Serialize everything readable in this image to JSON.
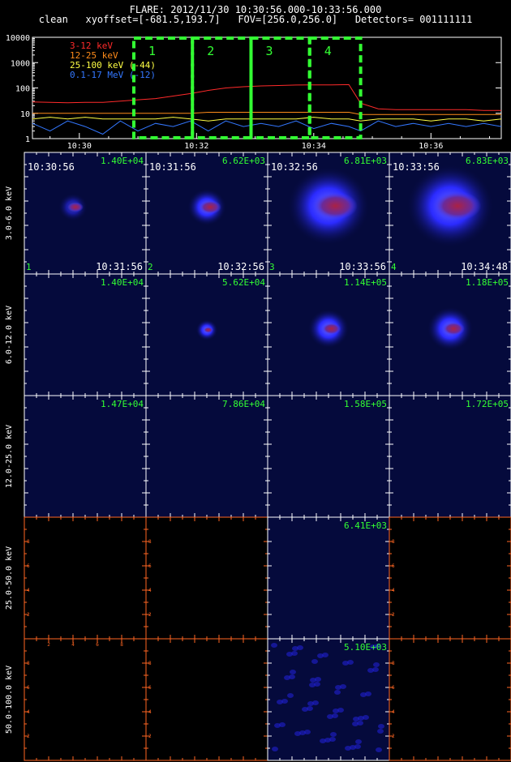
{
  "header": {
    "line1": "FLARE: 2012/11/30 10:30:56.000-10:33:56.000",
    "line2": "clean   xyoffset=[-681.5,193.7]   FOV=[256.0,256.0]   Detectors= 001111111"
  },
  "colors": {
    "bg": "#000000",
    "panel": "#050a3c",
    "frame": "#ffffff",
    "empty_frame": "#ff6622",
    "label_green": "#33ff33",
    "window_box": "#33ff33"
  },
  "chart_data": [
    {
      "type": "line",
      "title": "",
      "xlabel": "",
      "ylabel": "",
      "yscale": "log",
      "ylim": [
        1,
        10000
      ],
      "y_ticks": [
        "1",
        "10",
        "100",
        "1000",
        "10000"
      ],
      "x_ticks": [
        "10:30",
        "10:32",
        "10:34",
        "10:36"
      ],
      "x_tick_minutes": [
        30,
        32,
        34,
        36
      ],
      "xlim_minutes": [
        29.2,
        37.2
      ],
      "x": [
        29.2,
        29.5,
        29.8,
        30.1,
        30.4,
        30.7,
        31.0,
        31.3,
        31.6,
        31.9,
        32.2,
        32.5,
        32.8,
        33.1,
        33.4,
        33.7,
        34.0,
        34.3,
        34.6,
        34.8,
        35.1,
        35.4,
        35.7,
        36.0,
        36.3,
        36.6,
        36.9,
        37.2
      ],
      "series": [
        {
          "name": "3-12 keV",
          "color": "#ff2a2a",
          "values": [
            28,
            27,
            26,
            27,
            27,
            30,
            34,
            38,
            48,
            60,
            80,
            100,
            112,
            120,
            125,
            130,
            132,
            132,
            135,
            25,
            15,
            14,
            14,
            14,
            14,
            14,
            13,
            13
          ]
        },
        {
          "name": "12-25 keV",
          "color": "#ff8c1a",
          "values": [
            10,
            10,
            10,
            10,
            10,
            10,
            10,
            10,
            10,
            10,
            11,
            11,
            11,
            11,
            11,
            11,
            11,
            11,
            11,
            9,
            9,
            9,
            9,
            9,
            9,
            9,
            9,
            9
          ]
        },
        {
          "name": "25-100 keV (-44)",
          "color": "#ffff44",
          "values": [
            6,
            7,
            6,
            7,
            6,
            6,
            6,
            6,
            7,
            6,
            5,
            6,
            6,
            6,
            6,
            6,
            7,
            6,
            6,
            5,
            6,
            6,
            6,
            5,
            6,
            6,
            5,
            6
          ]
        },
        {
          "name": "0.1-17 MeV (-12)",
          "color": "#3377ff",
          "values": [
            4,
            2,
            5,
            3,
            1.5,
            5,
            2,
            4,
            3,
            5,
            2,
            5,
            3,
            4,
            3,
            5,
            2.5,
            4,
            3,
            2,
            5,
            3,
            4,
            3,
            4,
            3,
            4,
            3
          ]
        }
      ],
      "time_windows": [
        {
          "label": "1",
          "start_minutes": 30.93,
          "end_minutes": 31.93
        },
        {
          "label": "2",
          "start_minutes": 31.93,
          "end_minutes": 32.93
        },
        {
          "label": "3",
          "start_minutes": 32.93,
          "end_minutes": 33.93
        },
        {
          "label": "4",
          "start_minutes": 33.93,
          "end_minutes": 34.8
        }
      ]
    },
    {
      "type": "heatmap",
      "rows": [
        "3.0-6.0 keV",
        "6.0-12.0 keV",
        "12.0-25.0 keV",
        "25.0-50.0 keV",
        "50.0-100.0 keV"
      ],
      "columns": [
        "1",
        "2",
        "3",
        "4"
      ],
      "start_times": [
        "10:30:56",
        "10:31:56",
        "10:32:56",
        "10:33:56"
      ],
      "end_times": [
        "10:31:56",
        "10:32:56",
        "10:33:56",
        "10:34:48"
      ],
      "peaks": [
        [
          "1.40E+04",
          "6.62E+03",
          "6.81E+03",
          "6.83E+03"
        ],
        [
          "1.40E+04",
          "5.62E+04",
          "1.14E+05",
          "1.18E+05"
        ],
        [
          "1.47E+04",
          "7.86E+04",
          "1.58E+05",
          "1.72E+05"
        ],
        [
          "",
          "",
          "6.41E+03",
          ""
        ],
        [
          "",
          "",
          "5.10E+03",
          ""
        ]
      ],
      "empty_axis_ticks": [
        "2",
        "4",
        "6",
        "8"
      ]
    }
  ]
}
